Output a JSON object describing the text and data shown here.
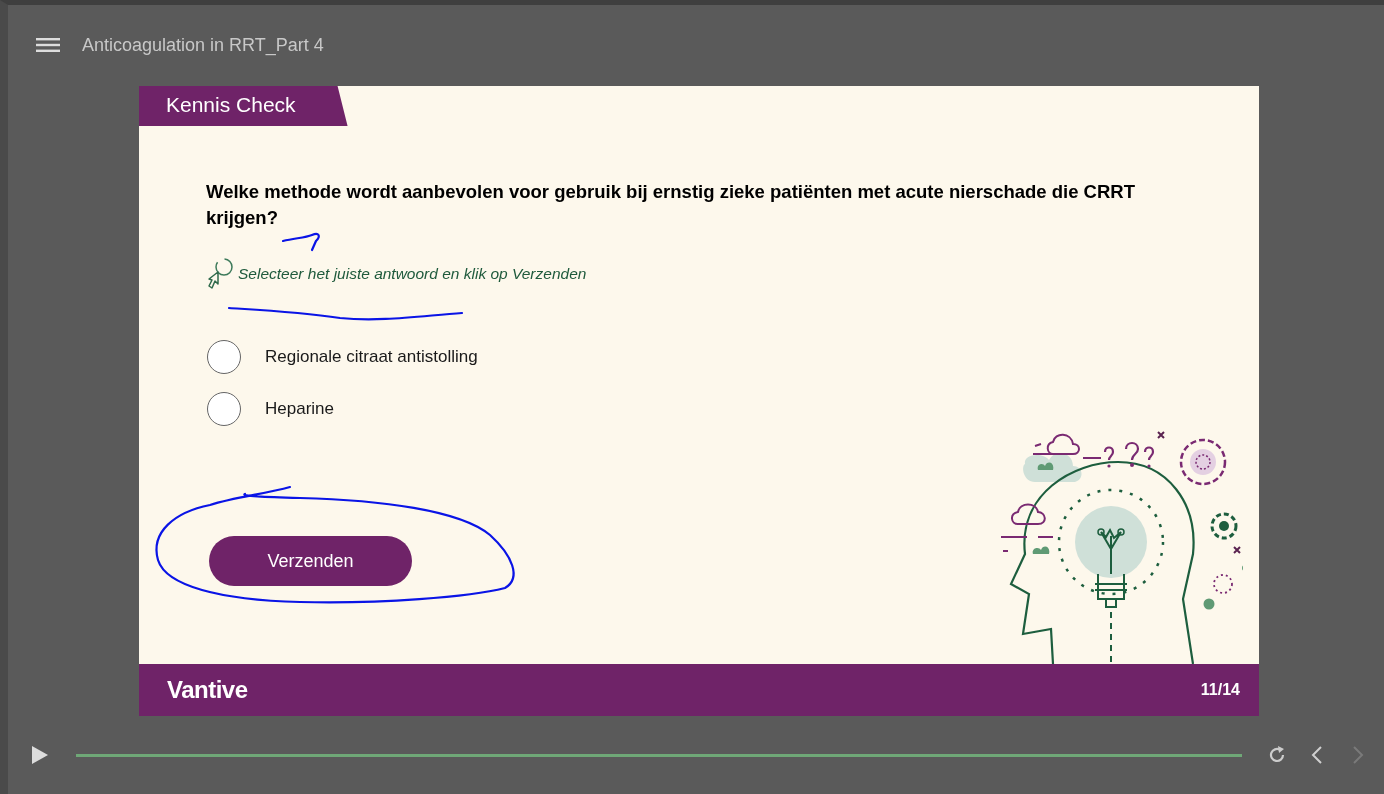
{
  "player": {
    "title": "Anticoagulation in RRT_Part 4"
  },
  "slide": {
    "banner": "Kennis Check",
    "question": "Welke methode wordt aanbevolen voor gebruik bij ernstig zieke patiënten met acute nierschade die CRRT krijgen?",
    "hint": "Selecteer het juiste antwoord en klik op Verzenden",
    "options": [
      {
        "label": "Regionale citraat antistolling",
        "selected": false
      },
      {
        "label": "Heparine",
        "selected": false
      }
    ],
    "submit": "Verzenden",
    "brand": "Vantive",
    "page": "11/14"
  },
  "controls": {
    "progress": {
      "level": 1
    },
    "previous": {
      "disabled": false
    },
    "next": {
      "disabled": true
    }
  }
}
